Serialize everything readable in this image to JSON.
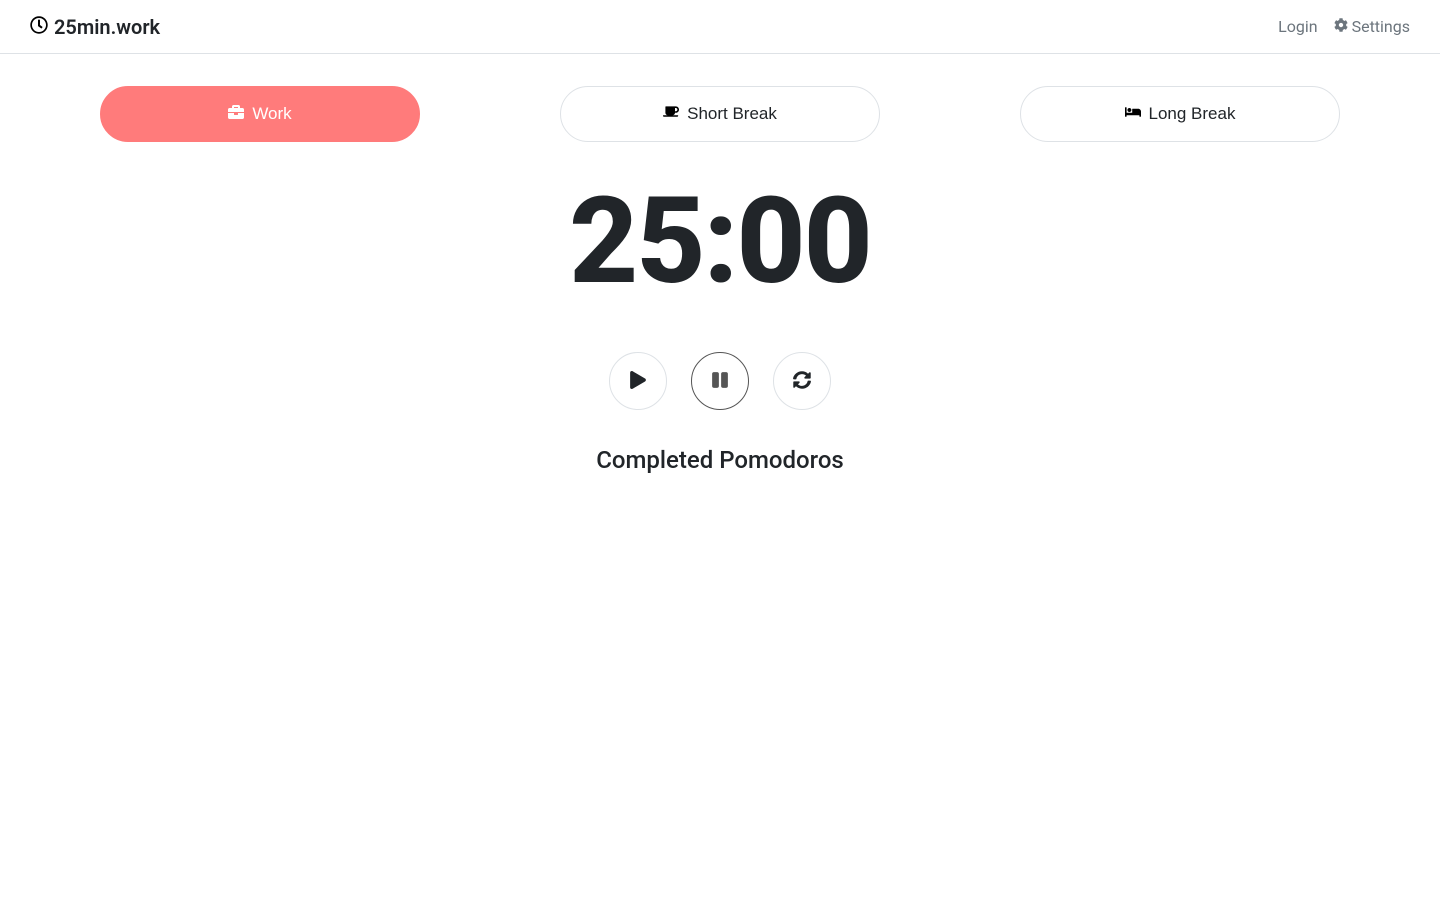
{
  "header": {
    "brand": "25min.work",
    "login": "Login",
    "settings": "Settings"
  },
  "modes": {
    "work": "Work",
    "short": "Short Break",
    "long": "Long Break",
    "active": "work"
  },
  "timer": {
    "display": "25:00"
  },
  "controls": {
    "active": "pause"
  },
  "completed": {
    "label": "Completed Pomodoros"
  },
  "colors": {
    "accent": "#ff7b7b",
    "text": "#212529",
    "muted": "#6c757d",
    "border": "#dee2e6"
  }
}
